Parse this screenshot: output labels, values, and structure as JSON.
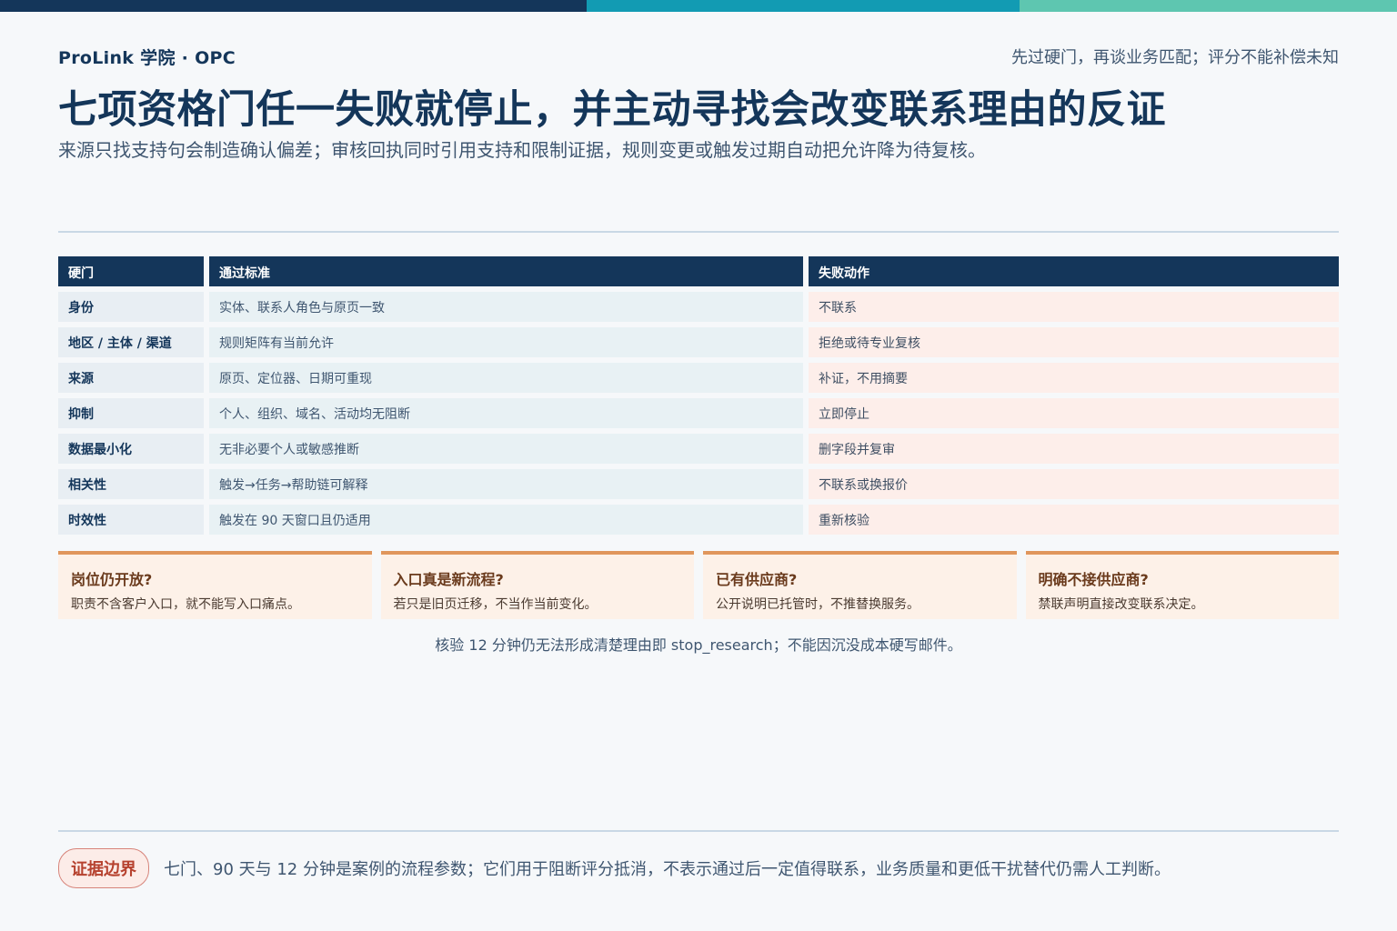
{
  "header": {
    "brand": "ProLink 学院 · OPC",
    "tagline": "先过硬门，再谈业务匹配；评分不能补偿未知",
    "title": "七项资格门任一失败就停止，并主动寻找会改变联系理由的反证",
    "subtitle": "来源只找支持句会制造确认偏差；审核回执同时引用支持和限制证据，规则变更或触发过期自动把允许降为待复核。"
  },
  "table": {
    "headers": [
      "硬门",
      "通过标准",
      "失败动作"
    ],
    "rows": [
      [
        "身份",
        "实体、联系人角色与原页一致",
        "不联系"
      ],
      [
        "地区 / 主体 / 渠道",
        "规则矩阵有当前允许",
        "拒绝或待专业复核"
      ],
      [
        "来源",
        "原页、定位器、日期可重现",
        "补证，不用摘要"
      ],
      [
        "抑制",
        "个人、组织、域名、活动均无阻断",
        "立即停止"
      ],
      [
        "数据最小化",
        "无非必要个人或敏感推断",
        "删字段并复审"
      ],
      [
        "相关性",
        "触发→任务→帮助链可解释",
        "不联系或换报价"
      ],
      [
        "时效性",
        "触发在 90 天窗口且仍适用",
        "重新核验"
      ]
    ]
  },
  "cards": [
    {
      "question": "岗位仍开放?",
      "answer": "职责不含客户入口，就不能写入口痛点。"
    },
    {
      "question": "入口真是新流程?",
      "answer": "若只是旧页迁移，不当作当前变化。"
    },
    {
      "question": "已有供应商?",
      "answer": "公开说明已托管时，不推替换服务。"
    },
    {
      "question": "明确不接供应商?",
      "answer": "禁联声明直接改变联系决定。"
    }
  ],
  "note": "核验 12 分钟仍无法形成清楚理由即 stop_research；不能因沉没成本硬写邮件。",
  "footer": {
    "badge": "证据边界",
    "text": "七门、90 天与 12 分钟是案例的流程参数；它们用于阻断评分抵消，不表示通过后一定值得联系，业务质量和更低干扰替代仍需人工判断。"
  },
  "colors": {
    "navy": "#14365a",
    "teal": "#129bb3",
    "mint": "#5ec6b0",
    "fail_bg": "#fdeeea",
    "card_accent": "#e0965c",
    "badge_red": "#b6422f"
  }
}
